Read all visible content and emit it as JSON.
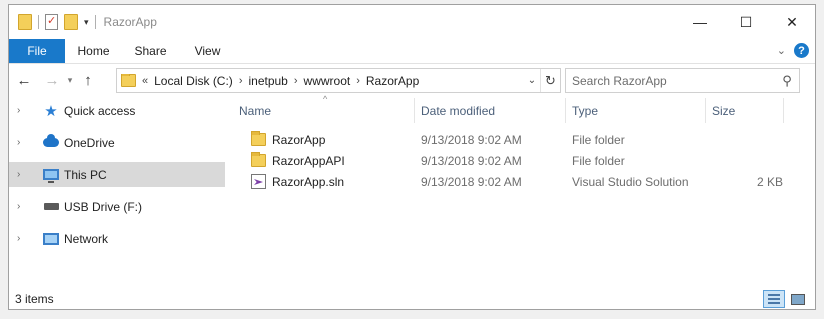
{
  "window": {
    "title": "RazorApp",
    "minimize_glyph": "—",
    "maximize_glyph": "☐",
    "close_glyph": "✕"
  },
  "quick_access_toolbar": {
    "icons": [
      "folder-icon",
      "properties-icon",
      "new-folder-icon"
    ],
    "dropdown_glyph": "▾"
  },
  "ribbon": {
    "tabs": [
      {
        "label": "File",
        "active": true
      },
      {
        "label": "Home"
      },
      {
        "label": "Share"
      },
      {
        "label": "View"
      }
    ],
    "expand_glyph": "⌄",
    "help_glyph": "?",
    "accent_color": "#1979ca"
  },
  "navigation": {
    "back_glyph": "←",
    "forward_glyph": "→",
    "recent_glyph": "▾",
    "up_glyph": "↑",
    "overflow_glyph": "«",
    "breadcrumbs": [
      "Local Disk (C:)",
      "inetpub",
      "wwwroot",
      "RazorApp"
    ],
    "separator_glyph": "›",
    "dropdown_glyph": "⌄",
    "refresh_glyph": "↻",
    "search_placeholder": "Search RazorApp",
    "search_value": "",
    "search_glyph": "⚲"
  },
  "nav_pane": {
    "items": [
      {
        "label": "Quick access",
        "icon": "star-icon"
      },
      {
        "label": "OneDrive",
        "icon": "cloud-icon"
      },
      {
        "label": "This PC",
        "icon": "computer-icon",
        "selected": true
      },
      {
        "label": "USB Drive (F:)",
        "icon": "usb-drive-icon"
      },
      {
        "label": "Network",
        "icon": "network-icon"
      }
    ],
    "chevron_glyph": "›"
  },
  "file_list": {
    "columns": [
      "Name",
      "Date modified",
      "Type",
      "Size"
    ],
    "sort_glyph": "^",
    "rows": [
      {
        "name": "RazorApp",
        "date": "9/13/2018 9:02 AM",
        "type": "File folder",
        "size": "",
        "icon": "folder-icon"
      },
      {
        "name": "RazorAppAPI",
        "date": "9/13/2018 9:02 AM",
        "type": "File folder",
        "size": "",
        "icon": "folder-icon"
      },
      {
        "name": "RazorApp.sln",
        "date": "9/13/2018 9:02 AM",
        "type": "Visual Studio Solution",
        "size": "2 KB",
        "icon": "visual-studio-solution-icon"
      }
    ]
  },
  "status_bar": {
    "item_count": "3 items"
  }
}
